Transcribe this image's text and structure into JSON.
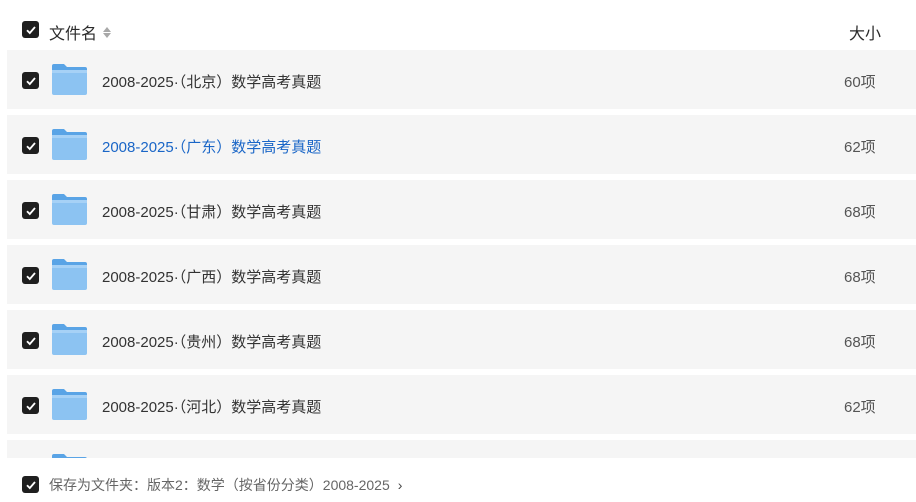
{
  "header": {
    "name_label": "文件名",
    "size_label": "大小"
  },
  "rows": [
    {
      "name": "2008-2025·（北京）数学高考真题",
      "size": "60项"
    },
    {
      "name": "2008-2025·（广东）数学高考真题",
      "size": "62项"
    },
    {
      "name": "2008-2025·（甘肃）数学高考真题",
      "size": "68项"
    },
    {
      "name": "2008-2025·（广西）数学高考真题",
      "size": "68项"
    },
    {
      "name": "2008-2025·（贵州）数学高考真题",
      "size": "68项"
    },
    {
      "name": "2008-2025·（河北）数学高考真题",
      "size": "62项"
    }
  ],
  "footer": {
    "save_path": "保存为文件夹：版本2：数学（按省份分类）2008-2025"
  },
  "colors": {
    "row_bg": "#f5f5f5",
    "hover_text": "#1a66c7",
    "checkbox": "#1f1f1f",
    "folder": "#6fb1ee"
  }
}
